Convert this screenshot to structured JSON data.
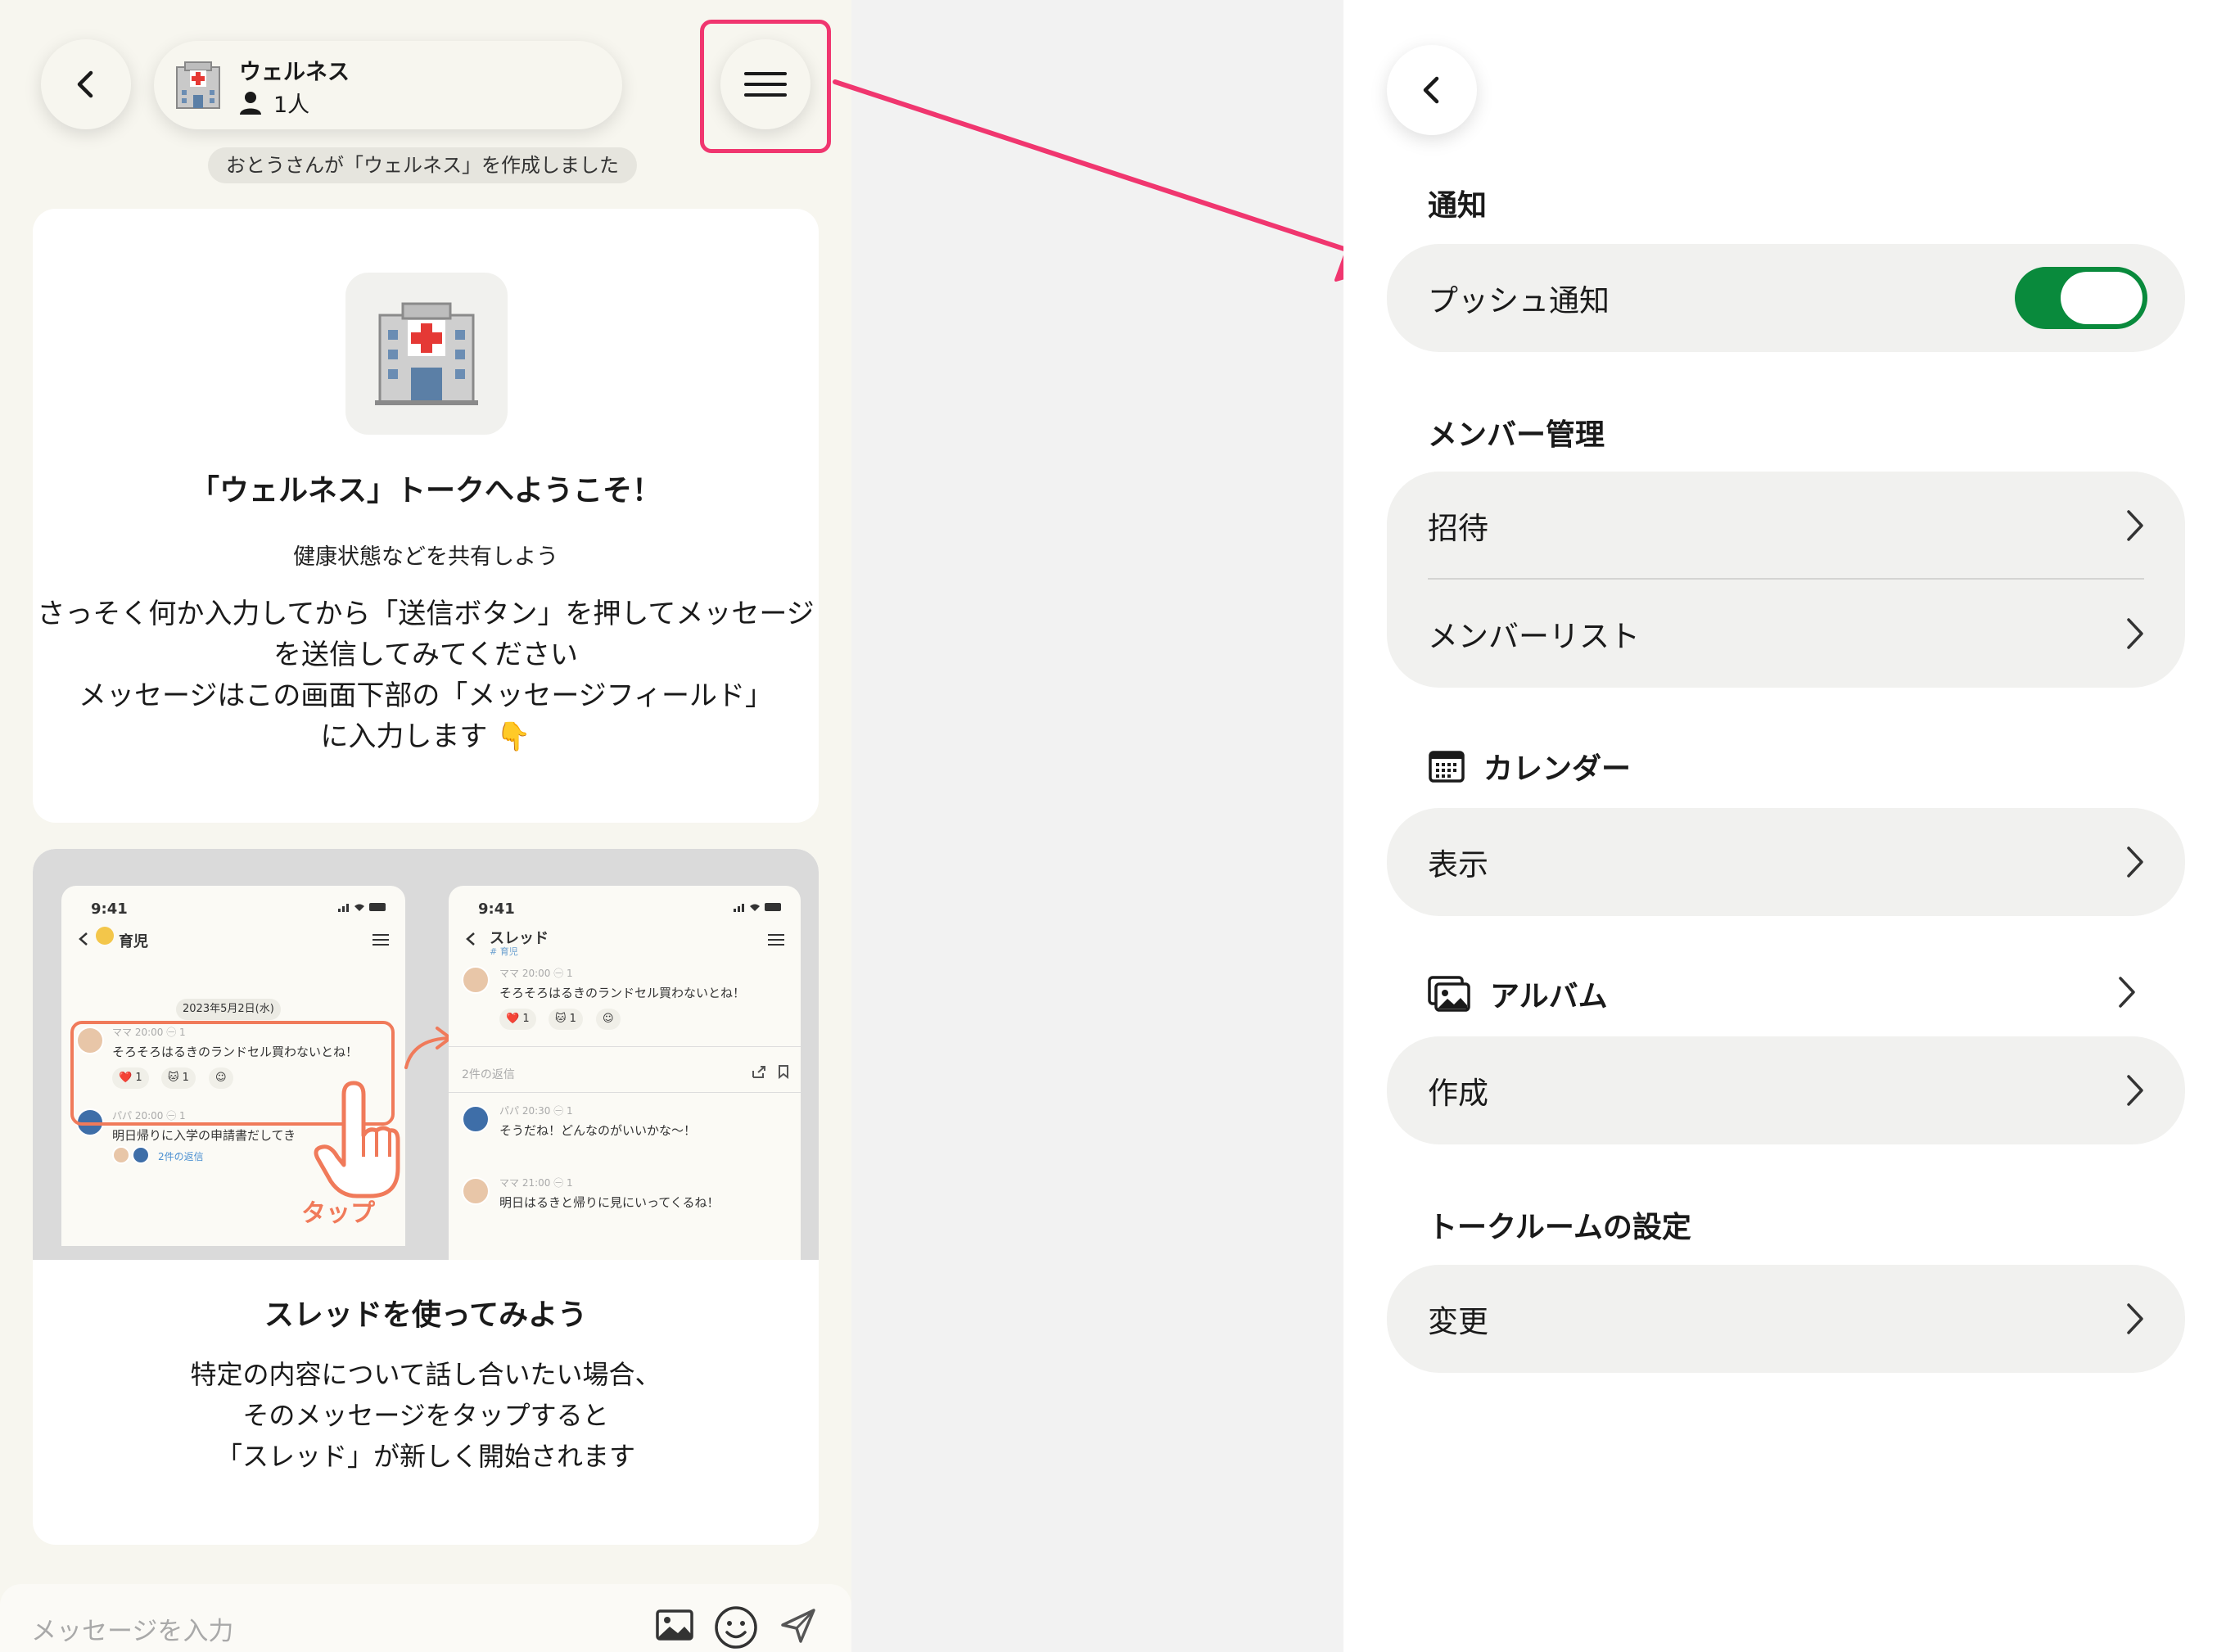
{
  "chat": {
    "room": {
      "name": "ウェルネス",
      "members": "1人"
    },
    "system_message": "おとうさんが「ウェルネス」を作成しました",
    "welcome": {
      "title": "「ウェルネス」トークへようこそ！",
      "subtitle": "健康状態などを共有しよう",
      "body_lines": [
        "さっそく何か入力してから「送信ボタン」を押してメッセージ",
        "を送信してみてください",
        "メッセージはこの画面下部の「メッセージフィールド」",
        "に入力します 👇"
      ]
    },
    "thread_card": {
      "title": "スレッドを使ってみよう",
      "body_lines": [
        "特定の内容について話し合いたい場合、",
        "そのメッセージをタップすると",
        "「スレッド」が新しく開始されます"
      ],
      "illustration": {
        "tap_label": "タップ",
        "screen_a": {
          "time": "9:41",
          "title": "育児",
          "date": "2023年5月2日(水)",
          "msg1_meta": "ママ 20:00 ㊀ 1",
          "msg1_text": "そろそろはるきのランドセル買わないとね！",
          "msg1_reactions": [
            "❤️ 1",
            "🐱 1",
            "☺"
          ],
          "msg2_meta": "パパ 20:00 ㊀ 1",
          "msg2_text": "明日帰りに入学の申請書だしてき",
          "msg2_replies": "2件の返信"
        },
        "screen_b": {
          "time": "9:41",
          "title": "スレッド",
          "subtitle": "# 育児",
          "msg1_meta": "ママ 20:00 ㊀ 1",
          "msg1_text": "そろそろはるきのランドセル買わないとね！",
          "msg1_reactions": [
            "❤️ 1",
            "🐱 1",
            "☺"
          ],
          "replies_label": "2件の返信",
          "msg2_meta": "パパ 20:30 ㊀ 1",
          "msg2_text": "そうだね！どんなのがいいかな〜！",
          "msg3_meta": "ママ 21:00 ㊀ 1",
          "msg3_text": "明日はるきと帰りに見にいってくるね！"
        }
      }
    },
    "input": {
      "placeholder": "メッセージを入力"
    }
  },
  "settings": {
    "sections": {
      "notification": {
        "title": "通知",
        "push_label": "プッシュ通知",
        "push_enabled": true
      },
      "members": {
        "title": "メンバー管理",
        "invite": "招待",
        "member_list": "メンバーリスト"
      },
      "calendar": {
        "title": "カレンダー",
        "view": "表示"
      },
      "album": {
        "title": "アルバム",
        "create": "作成"
      },
      "talkroom": {
        "title": "トークルームの設定",
        "change": "変更"
      }
    }
  },
  "colors": {
    "highlight": "#f0366f",
    "toggle_on": "#098a3c",
    "chat_bg": "#f7f6ef",
    "row_bg": "#f1f1ef",
    "tap_accent": "#f07a5a"
  }
}
